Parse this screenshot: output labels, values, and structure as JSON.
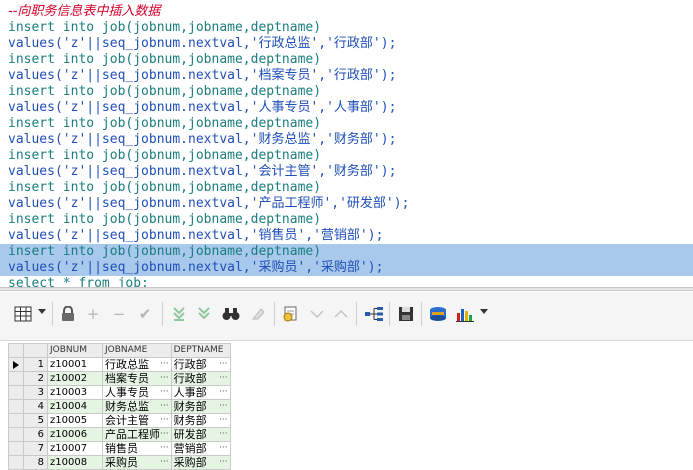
{
  "editor": {
    "lines": [
      {
        "type": "comment",
        "text": "--向职务信息表中插入数据"
      },
      {
        "type": "insert",
        "text": "insert into job(jobnum,jobname,deptname)"
      },
      {
        "type": "values",
        "text": "values('z'||seq_jobnum.nextval,'行政总监','行政部');"
      },
      {
        "type": "insert",
        "text": "insert into job(jobnum,jobname,deptname)"
      },
      {
        "type": "values",
        "text": "values('z'||seq_jobnum.nextval,'档案专员','行政部');"
      },
      {
        "type": "insert",
        "text": "insert into job(jobnum,jobname,deptname)"
      },
      {
        "type": "values",
        "text": "values('z'||seq_jobnum.nextval,'人事专员','人事部');"
      },
      {
        "type": "insert",
        "text": "insert into job(jobnum,jobname,deptname)"
      },
      {
        "type": "values",
        "text": "values('z'||seq_jobnum.nextval,'财务总监','财务部');"
      },
      {
        "type": "insert",
        "text": "insert into job(jobnum,jobname,deptname)"
      },
      {
        "type": "values",
        "text": "values('z'||seq_jobnum.nextval,'会计主管','财务部');"
      },
      {
        "type": "insert",
        "text": "insert into job(jobnum,jobname,deptname)"
      },
      {
        "type": "values",
        "text": "values('z'||seq_jobnum.nextval,'产品工程师','研发部');"
      },
      {
        "type": "insert",
        "text": "insert into job(jobnum,jobname,deptname)"
      },
      {
        "type": "values",
        "text": "values('z'||seq_jobnum.nextval,'销售员','营销部');"
      },
      {
        "type": "insert",
        "text": "insert into job(jobnum,jobname,deptname)",
        "selected": true
      },
      {
        "type": "values",
        "text": "values('z'||seq_jobnum.nextval,'采购员','采购部');",
        "selected": true
      },
      {
        "type": "insert",
        "text": "select * from job;"
      }
    ],
    "colors": {
      "comment": "#d4002a",
      "keyword": "#1a7d80",
      "values": "#1f4fb8",
      "selection": "#a8c8ec"
    }
  },
  "toolbar": {
    "icons": [
      "grid-view-icon",
      "lock-icon",
      "add-record-icon",
      "delete-record-icon",
      "post-changes-icon",
      "fetch-next-icon",
      "fetch-all-icon",
      "find-icon",
      "clear-icon",
      "query-by-example-icon",
      "previous-query-icon",
      "next-query-icon",
      "query-tree-icon",
      "save-icon",
      "export-icon",
      "chart-icon"
    ]
  },
  "grid": {
    "columns": [
      "JOBNUM",
      "JOBNAME",
      "DEPTNAME"
    ],
    "rows": [
      {
        "num": "1",
        "jobnum": "z10001",
        "jobname": "行政总监",
        "deptname": "行政部"
      },
      {
        "num": "2",
        "jobnum": "z10002",
        "jobname": "档案专员",
        "deptname": "行政部"
      },
      {
        "num": "3",
        "jobnum": "z10003",
        "jobname": "人事专员",
        "deptname": "人事部"
      },
      {
        "num": "4",
        "jobnum": "z10004",
        "jobname": "财务总监",
        "deptname": "财务部"
      },
      {
        "num": "5",
        "jobnum": "z10005",
        "jobname": "会计主管",
        "deptname": "财务部"
      },
      {
        "num": "6",
        "jobnum": "z10006",
        "jobname": "产品工程师",
        "deptname": "研发部"
      },
      {
        "num": "7",
        "jobnum": "z10007",
        "jobname": "销售员",
        "deptname": "营销部"
      },
      {
        "num": "8",
        "jobnum": "z10008",
        "jobname": "采购员",
        "deptname": "采购部"
      }
    ],
    "cell_dots": "···"
  }
}
